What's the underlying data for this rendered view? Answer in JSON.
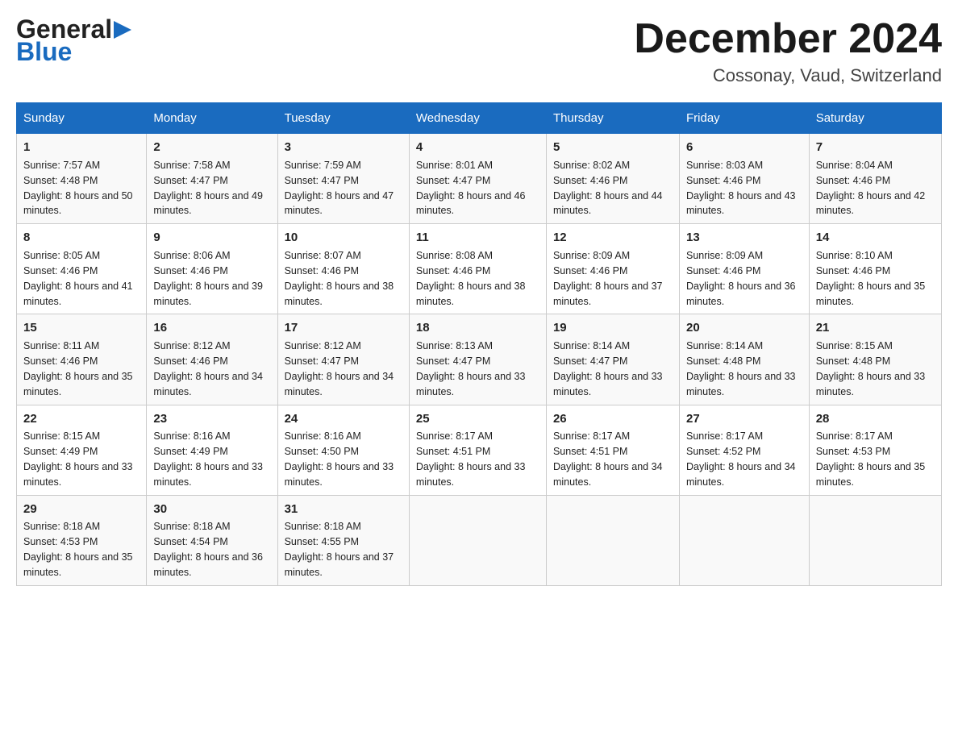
{
  "header": {
    "title": "December 2024",
    "location": "Cossonay, Vaud, Switzerland",
    "logo_general": "General",
    "logo_blue": "Blue"
  },
  "days_header": [
    "Sunday",
    "Monday",
    "Tuesday",
    "Wednesday",
    "Thursday",
    "Friday",
    "Saturday"
  ],
  "weeks": [
    [
      {
        "day": "1",
        "sunrise": "7:57 AM",
        "sunset": "4:48 PM",
        "daylight": "8 hours and 50 minutes."
      },
      {
        "day": "2",
        "sunrise": "7:58 AM",
        "sunset": "4:47 PM",
        "daylight": "8 hours and 49 minutes."
      },
      {
        "day": "3",
        "sunrise": "7:59 AM",
        "sunset": "4:47 PM",
        "daylight": "8 hours and 47 minutes."
      },
      {
        "day": "4",
        "sunrise": "8:01 AM",
        "sunset": "4:47 PM",
        "daylight": "8 hours and 46 minutes."
      },
      {
        "day": "5",
        "sunrise": "8:02 AM",
        "sunset": "4:46 PM",
        "daylight": "8 hours and 44 minutes."
      },
      {
        "day": "6",
        "sunrise": "8:03 AM",
        "sunset": "4:46 PM",
        "daylight": "8 hours and 43 minutes."
      },
      {
        "day": "7",
        "sunrise": "8:04 AM",
        "sunset": "4:46 PM",
        "daylight": "8 hours and 42 minutes."
      }
    ],
    [
      {
        "day": "8",
        "sunrise": "8:05 AM",
        "sunset": "4:46 PM",
        "daylight": "8 hours and 41 minutes."
      },
      {
        "day": "9",
        "sunrise": "8:06 AM",
        "sunset": "4:46 PM",
        "daylight": "8 hours and 39 minutes."
      },
      {
        "day": "10",
        "sunrise": "8:07 AM",
        "sunset": "4:46 PM",
        "daylight": "8 hours and 38 minutes."
      },
      {
        "day": "11",
        "sunrise": "8:08 AM",
        "sunset": "4:46 PM",
        "daylight": "8 hours and 38 minutes."
      },
      {
        "day": "12",
        "sunrise": "8:09 AM",
        "sunset": "4:46 PM",
        "daylight": "8 hours and 37 minutes."
      },
      {
        "day": "13",
        "sunrise": "8:09 AM",
        "sunset": "4:46 PM",
        "daylight": "8 hours and 36 minutes."
      },
      {
        "day": "14",
        "sunrise": "8:10 AM",
        "sunset": "4:46 PM",
        "daylight": "8 hours and 35 minutes."
      }
    ],
    [
      {
        "day": "15",
        "sunrise": "8:11 AM",
        "sunset": "4:46 PM",
        "daylight": "8 hours and 35 minutes."
      },
      {
        "day": "16",
        "sunrise": "8:12 AM",
        "sunset": "4:46 PM",
        "daylight": "8 hours and 34 minutes."
      },
      {
        "day": "17",
        "sunrise": "8:12 AM",
        "sunset": "4:47 PM",
        "daylight": "8 hours and 34 minutes."
      },
      {
        "day": "18",
        "sunrise": "8:13 AM",
        "sunset": "4:47 PM",
        "daylight": "8 hours and 33 minutes."
      },
      {
        "day": "19",
        "sunrise": "8:14 AM",
        "sunset": "4:47 PM",
        "daylight": "8 hours and 33 minutes."
      },
      {
        "day": "20",
        "sunrise": "8:14 AM",
        "sunset": "4:48 PM",
        "daylight": "8 hours and 33 minutes."
      },
      {
        "day": "21",
        "sunrise": "8:15 AM",
        "sunset": "4:48 PM",
        "daylight": "8 hours and 33 minutes."
      }
    ],
    [
      {
        "day": "22",
        "sunrise": "8:15 AM",
        "sunset": "4:49 PM",
        "daylight": "8 hours and 33 minutes."
      },
      {
        "day": "23",
        "sunrise": "8:16 AM",
        "sunset": "4:49 PM",
        "daylight": "8 hours and 33 minutes."
      },
      {
        "day": "24",
        "sunrise": "8:16 AM",
        "sunset": "4:50 PM",
        "daylight": "8 hours and 33 minutes."
      },
      {
        "day": "25",
        "sunrise": "8:17 AM",
        "sunset": "4:51 PM",
        "daylight": "8 hours and 33 minutes."
      },
      {
        "day": "26",
        "sunrise": "8:17 AM",
        "sunset": "4:51 PM",
        "daylight": "8 hours and 34 minutes."
      },
      {
        "day": "27",
        "sunrise": "8:17 AM",
        "sunset": "4:52 PM",
        "daylight": "8 hours and 34 minutes."
      },
      {
        "day": "28",
        "sunrise": "8:17 AM",
        "sunset": "4:53 PM",
        "daylight": "8 hours and 35 minutes."
      }
    ],
    [
      {
        "day": "29",
        "sunrise": "8:18 AM",
        "sunset": "4:53 PM",
        "daylight": "8 hours and 35 minutes."
      },
      {
        "day": "30",
        "sunrise": "8:18 AM",
        "sunset": "4:54 PM",
        "daylight": "8 hours and 36 minutes."
      },
      {
        "day": "31",
        "sunrise": "8:18 AM",
        "sunset": "4:55 PM",
        "daylight": "8 hours and 37 minutes."
      },
      {
        "day": "",
        "sunrise": "",
        "sunset": "",
        "daylight": ""
      },
      {
        "day": "",
        "sunrise": "",
        "sunset": "",
        "daylight": ""
      },
      {
        "day": "",
        "sunrise": "",
        "sunset": "",
        "daylight": ""
      },
      {
        "day": "",
        "sunrise": "",
        "sunset": "",
        "daylight": ""
      }
    ]
  ]
}
